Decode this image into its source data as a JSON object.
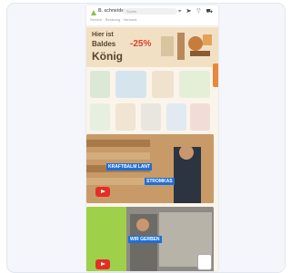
{
  "header": {
    "logo_text": "B. schneider",
    "search_placeholder": "Suche",
    "icons": [
      "pin-icon",
      "send-icon",
      "heart-icon",
      "cart-icon"
    ],
    "subnav_text": "Service · Beratung · Versand"
  },
  "promo": {
    "line1": "Hier ist",
    "line2": "Baldes",
    "line3": "König",
    "discount": "-25%"
  },
  "videos": [
    {
      "label": "KRAFTBALM LANT",
      "sublabel": "STROMKAS"
    },
    {
      "label": "WIR GERBEN"
    }
  ],
  "colors": {
    "accent": "#e8883a",
    "promo_bg": "#f2e0c5",
    "play": "#e52d27",
    "label_bg": "#1f6fd6"
  }
}
